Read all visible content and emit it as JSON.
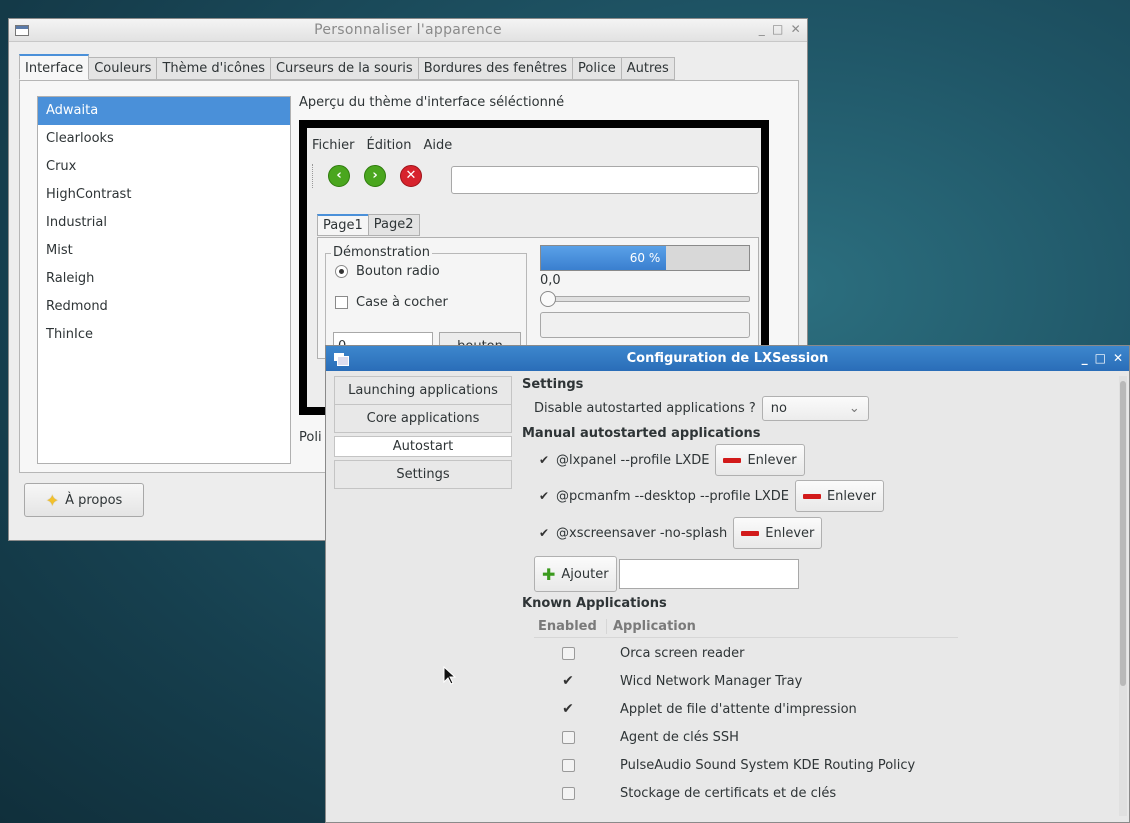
{
  "w1": {
    "title": "Personnaliser l'apparence",
    "tabs": [
      "Interface",
      "Couleurs",
      "Thème d'icônes",
      "Curseurs de la souris",
      "Bordures des fenêtres",
      "Police",
      "Autres"
    ],
    "themes": [
      "Adwaita",
      "Clearlooks",
      "Crux",
      "HighContrast",
      "Industrial",
      "Mist",
      "Raleigh",
      "Redmond",
      "ThinIce"
    ],
    "preview_label": "Aperçu du thème d'interface séléctionné",
    "preview": {
      "menu": [
        "Fichier",
        "Édition",
        "Aide"
      ],
      "tabs": [
        "Page1",
        "Page2"
      ],
      "demo_legend": "Démonstration",
      "radio_label": "Bouton radio",
      "check_label": "Case à cocher",
      "spin_value": "0",
      "button_label": "bouton",
      "progress_value": 0.6,
      "progress_text": "60 %",
      "slider_value": "0,0"
    },
    "police_label": "Poli",
    "about_label": "À propos"
  },
  "w2": {
    "title": "Configuration de LXSession",
    "side": [
      "Launching applications",
      "Core applications",
      "Autostart",
      "Settings"
    ],
    "settings_header": "Settings",
    "disable_label": "Disable autostarted applications ?",
    "disable_value": "no",
    "manual_header": "Manual autostarted applications",
    "manual": [
      "@lxpanel --profile LXDE",
      "@pcmanfm --desktop --profile LXDE",
      "@xscreensaver -no-splash"
    ],
    "remove_label": "Enlever",
    "add_label": "Ajouter",
    "known_header": "Known Applications",
    "col_enabled": "Enabled",
    "col_app": "Application",
    "known": [
      {
        "name": "Orca screen reader",
        "enabled": false
      },
      {
        "name": "Wicd Network Manager Tray",
        "enabled": true
      },
      {
        "name": "Applet de file d'attente d'impression",
        "enabled": true
      },
      {
        "name": "Agent de clés SSH",
        "enabled": false
      },
      {
        "name": "PulseAudio Sound System KDE Routing Policy",
        "enabled": false
      },
      {
        "name": "Stockage de certificats et de clés",
        "enabled": false
      }
    ]
  },
  "colors": {
    "accent": "#4a90d9",
    "titlebar_active": "#3279c4",
    "remove": "#d21a1a",
    "add": "#3a9a1d"
  }
}
